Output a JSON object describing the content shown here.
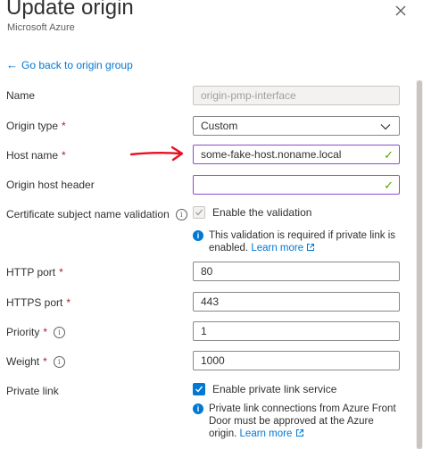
{
  "header": {
    "title": "Update origin",
    "subtitle": "Microsoft Azure"
  },
  "back_link": "Go back to origin group",
  "fields": {
    "name": {
      "label": "Name",
      "value": "origin-pmp-interface"
    },
    "origin_type": {
      "label": "Origin type",
      "value": "Custom"
    },
    "host_name": {
      "label": "Host name",
      "value": "some-fake-host.noname.local"
    },
    "origin_host_header": {
      "label": "Origin host header",
      "value": ""
    },
    "cert_validation": {
      "label": "Certificate subject name validation",
      "checkbox_label": "Enable the validation",
      "note": "This validation is required if private link is enabled.",
      "link": "Learn more"
    },
    "http_port": {
      "label": "HTTP port",
      "value": "80"
    },
    "https_port": {
      "label": "HTTPS port",
      "value": "443"
    },
    "priority": {
      "label": "Priority",
      "value": "1"
    },
    "weight": {
      "label": "Weight",
      "value": "1000"
    },
    "private_link": {
      "label": "Private link",
      "checkbox_label": "Enable private link service",
      "note": "Private link connections from Azure Front Door must be approved at the Azure origin.",
      "link": "Learn more"
    }
  },
  "required_marker": "*",
  "colors": {
    "accent": "#0078d4",
    "required": "#a4262c",
    "valid_check": "#57a300",
    "focus_border": "#8a4ed0",
    "annotation_arrow": "#e81123"
  },
  "icons": {
    "close": "close-icon",
    "back": "back-arrow-icon",
    "dropdown": "chevron-down-icon",
    "info": "info-icon",
    "external": "external-link-icon",
    "valid": "checkmark-icon"
  }
}
